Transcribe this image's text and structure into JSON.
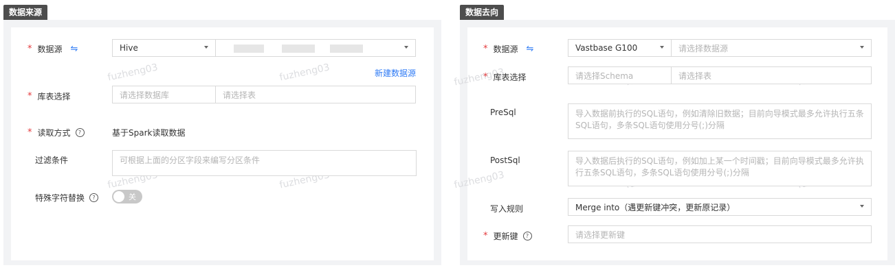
{
  "left": {
    "tag": "数据来源",
    "watermark": "fuzheng03",
    "datasource": {
      "label": "数据源",
      "type_value": "Hive",
      "new_link": "新建数据源"
    },
    "table_select": {
      "label": "库表选择",
      "db_placeholder": "请选择数据库",
      "table_placeholder": "请选择表"
    },
    "read_mode": {
      "label": "读取方式",
      "value": "基于Spark读取数据"
    },
    "filter": {
      "label": "过滤条件",
      "placeholder": "可根据上面的分区字段来编写分区条件"
    },
    "special_char": {
      "label": "特殊字符替换",
      "toggle_text": "关"
    }
  },
  "right": {
    "tag": "数据去向",
    "watermark": "fuzheng03",
    "datasource": {
      "label": "数据源",
      "type_value": "Vastbase G100",
      "source_placeholder": "请选择数据源"
    },
    "table_select": {
      "label": "库表选择",
      "schema_placeholder": "请选择Schema",
      "table_placeholder": "请选择表"
    },
    "presql": {
      "label": "PreSql",
      "placeholder": "导入数据前执行的SQL语句，例如清除旧数据；目前向导模式最多允许执行五条SQL语句，多条SQL语句使用分号(;)分隔"
    },
    "postsql": {
      "label": "PostSql",
      "placeholder": "导入数据后执行的SQL语句，例如加上某一个时间戳；目前向导模式最多允许执行五条SQL语句，多条SQL语句使用分号(;)分隔"
    },
    "write_rule": {
      "label": "写入规则",
      "value": "Merge into（遇更新键冲突，更新原记录）"
    },
    "update_key": {
      "label": "更新键",
      "placeholder": "请选择更新键"
    }
  },
  "common": {
    "required_mark": "*",
    "help_mark": "?",
    "swap_mark": "⇋"
  },
  "colors": {
    "accent": "#2f7bf5",
    "required": "#e4393c",
    "tag_bg": "#4d4d4d",
    "panel_bg": "#f2f3f5"
  }
}
